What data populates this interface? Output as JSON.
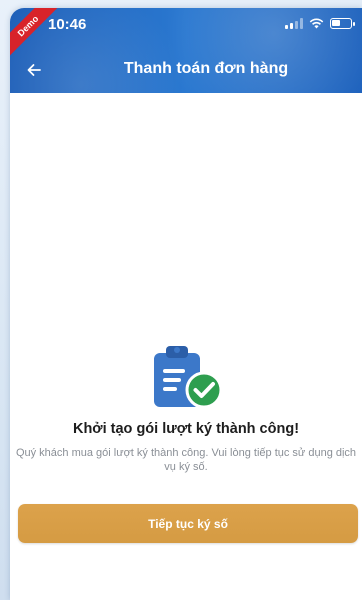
{
  "status_bar": {
    "time": "10:46",
    "demo_label": "Demo"
  },
  "header": {
    "title": "Thanh toán đơn hàng"
  },
  "result": {
    "title": "Khởi tạo gói lượt ký thành công!",
    "description": "Quý khách mua gói lượt ký thành công. Vui lòng tiếp tục sử dụng dịch vụ ký số."
  },
  "actions": {
    "continue_label": "Tiếp tục ký số"
  },
  "colors": {
    "header_blue": "#1e62bd",
    "button_gold": "#d8a047",
    "success_green": "#2e9e4f",
    "clipboard_blue": "#3c78c9"
  },
  "icons": [
    "back-arrow-icon",
    "signal-icon",
    "wifi-icon",
    "battery-icon",
    "clipboard-check-icon"
  ]
}
